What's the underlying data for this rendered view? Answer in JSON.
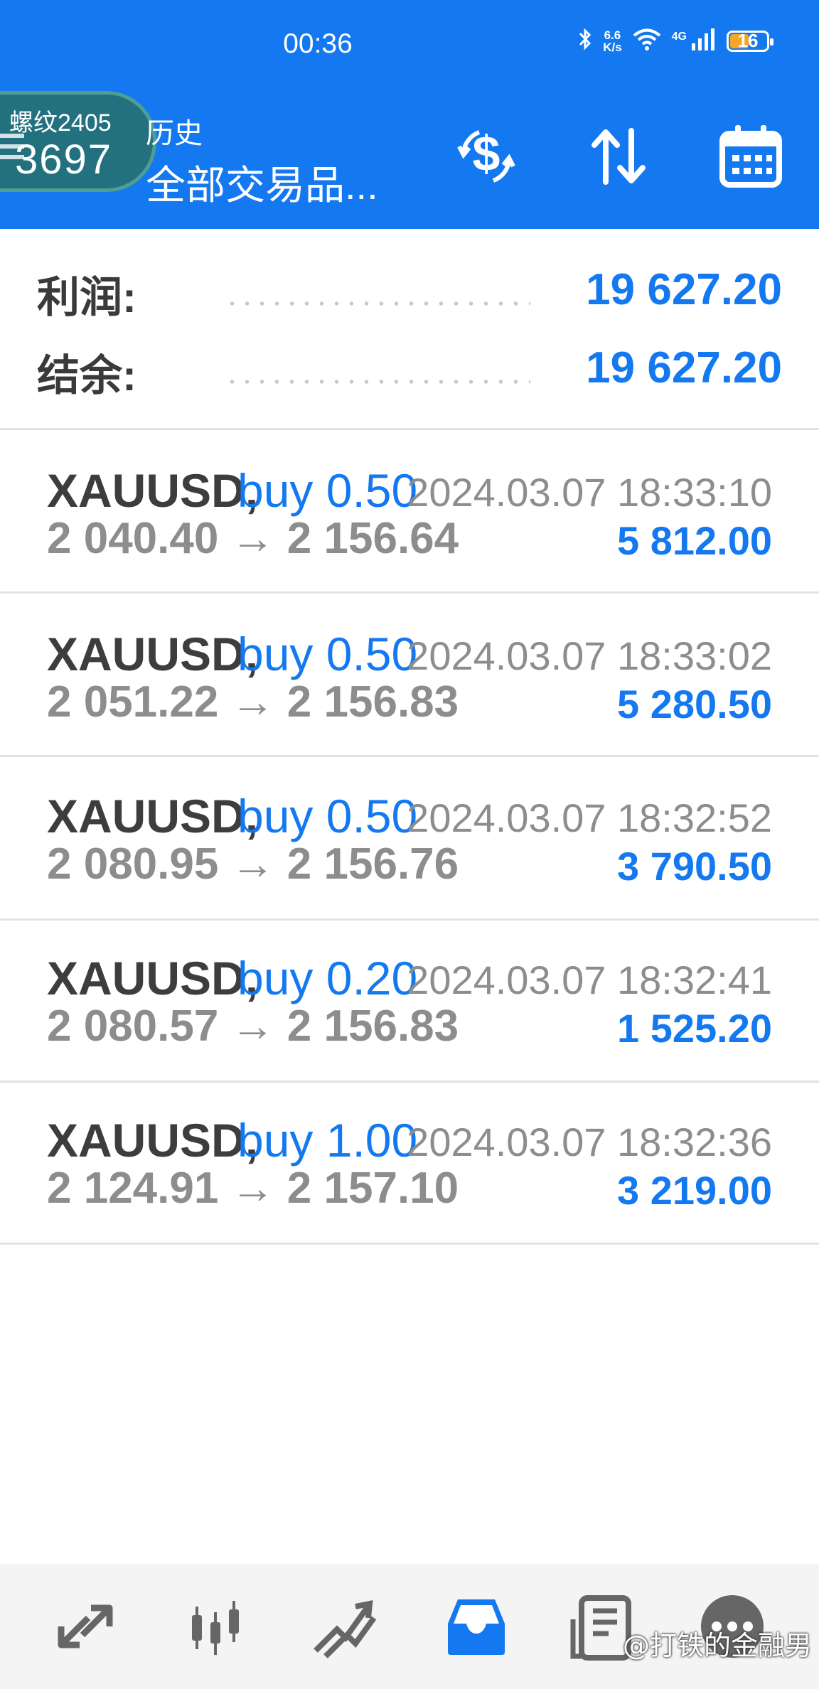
{
  "status_bar": {
    "time": "00:36",
    "net_speed_top": "6.6",
    "net_speed_bottom": "K/s",
    "net_type": "4G",
    "battery": "16"
  },
  "overlay": {
    "line1": "螺纹2405",
    "line2": "3697"
  },
  "header": {
    "subtitle": "历史",
    "title": "全部交易品...",
    "icons": [
      "money-swap-icon",
      "sort-icon",
      "calendar-icon"
    ]
  },
  "summary": {
    "profit_label": "利润:",
    "profit_value": "19 627.20",
    "balance_label": "结余:",
    "balance_value": "19 627.20"
  },
  "trades": [
    {
      "symbol": "XAUUSD,",
      "side": "buy 0.50",
      "time": "2024.03.07 18:33:10",
      "prices": "2 040.40 → 2 156.64",
      "profit": "5 812.00"
    },
    {
      "symbol": "XAUUSD,",
      "side": "buy 0.50",
      "time": "2024.03.07 18:33:02",
      "prices": "2 051.22 → 2 156.83",
      "profit": "5 280.50"
    },
    {
      "symbol": "XAUUSD,",
      "side": "buy 0.50",
      "time": "2024.03.07 18:32:52",
      "prices": "2 080.95 → 2 156.76",
      "profit": "3 790.50"
    },
    {
      "symbol": "XAUUSD,",
      "side": "buy 0.20",
      "time": "2024.03.07 18:32:41",
      "prices": "2 080.57 → 2 156.83",
      "profit": "1 525.20"
    },
    {
      "symbol": "XAUUSD,",
      "side": "buy 1.00",
      "time": "2024.03.07 18:32:36",
      "prices": "2 124.91 → 2 157.10",
      "profit": "3 219.00"
    }
  ],
  "bottom_nav": [
    "quotes-icon",
    "chart-icon",
    "trade-icon",
    "history-icon",
    "news-icon",
    "more-icon"
  ],
  "watermark": "@打铁的金融男",
  "colors": {
    "accent": "#1479f0",
    "battery": "#f6a623"
  }
}
